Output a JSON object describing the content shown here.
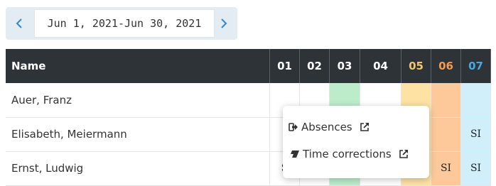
{
  "date_nav": {
    "prev_icon": "chevron-left-icon",
    "next_icon": "chevron-right-icon",
    "range_label": "Jun 1, 2021-Jun 30, 2021"
  },
  "table": {
    "name_header": "Name",
    "days": [
      {
        "label": "01",
        "kind": "weekday"
      },
      {
        "label": "02",
        "kind": "weekday"
      },
      {
        "label": "03",
        "kind": "weekday"
      },
      {
        "label": "04",
        "kind": "weekday"
      },
      {
        "label": "05",
        "kind": "saturday",
        "color": "#f1c470"
      },
      {
        "label": "06",
        "kind": "sunday",
        "color": "#f39a55"
      },
      {
        "label": "07",
        "kind": "holiday",
        "color": "#4aa8e0"
      }
    ],
    "rows": [
      {
        "name": "Auer, Franz",
        "cells": [
          "",
          "",
          "",
          "",
          "",
          "",
          ""
        ]
      },
      {
        "name": "Elisabeth, Meiermann",
        "cells": [
          "",
          "",
          "",
          "",
          "",
          "",
          "SI"
        ]
      },
      {
        "name": "Ernst, Ludwig",
        "cells": [
          "S",
          "",
          "",
          "",
          "",
          "SI",
          "SI"
        ]
      }
    ],
    "colors": {
      "header_bg": "#2e3338",
      "green": "#bdeccb",
      "saturday": "#fde2a4",
      "sunday": "#fdc99a",
      "holiday": "#d1eefb"
    }
  },
  "context_menu": {
    "items": [
      {
        "label": "Absences",
        "icon": "sign-out-icon",
        "ext_icon": "external-link-icon"
      },
      {
        "label": "Time corrections",
        "icon": "eraser-icon",
        "ext_icon": "external-link-icon"
      }
    ]
  }
}
